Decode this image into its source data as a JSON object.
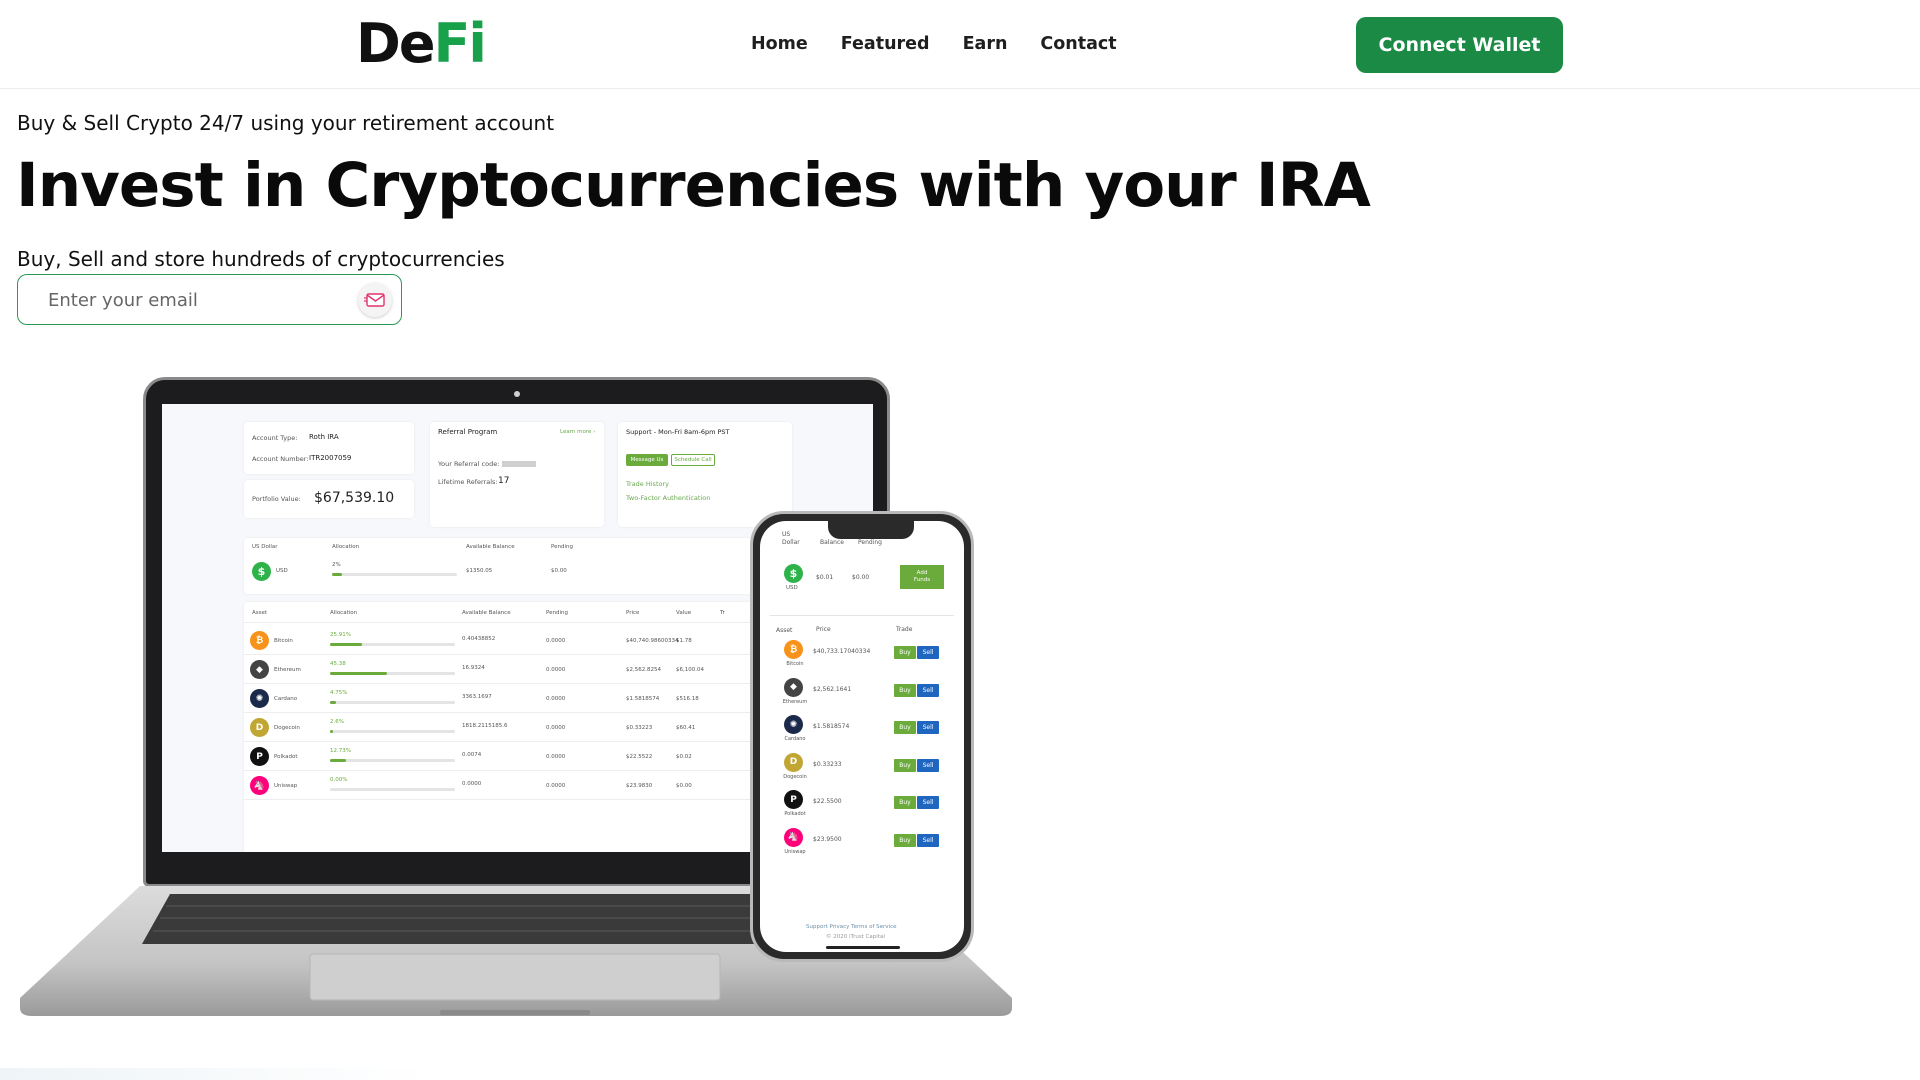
{
  "header": {
    "logo_part1": "De",
    "logo_part2": "Fi",
    "nav": [
      "Home",
      "Featured",
      "Earn",
      "Contact"
    ],
    "connect_wallet": "Connect Wallet"
  },
  "hero": {
    "eyebrow": "Buy & Sell Crypto 24/7 using your retirement account",
    "headline": "Invest in Cryptocurrencies with your IRA",
    "subline": "Buy, Sell and store hundreds of cryptocurrencies",
    "email_placeholder": "Enter your email"
  },
  "colors": {
    "brand_green": "#1a8a45",
    "logo_green": "#18a04a",
    "input_border": "#2c9a55"
  },
  "mockup": {
    "account": {
      "account_type_label": "Account Type:",
      "account_type": "Roth IRA",
      "account_number_label": "Account Number:",
      "account_number": "ITR2007059",
      "portfolio_label": "Portfolio Value:",
      "portfolio_value": "$67,539.10"
    },
    "referral": {
      "title": "Referral Program",
      "learn_more": "Learn more ›",
      "code_label": "Your Referral code:",
      "lifetime_label": "Lifetime Referrals:",
      "lifetime_value": "17"
    },
    "support": {
      "title": "Support - Mon-Fri 8am-6pm PST",
      "message_us": "Message Us",
      "schedule_call": "Schedule Call",
      "trade_history": "Trade History",
      "two_factor": "Two-Factor Authentication"
    },
    "usd": {
      "headers": [
        "US Dollar",
        "Allocation",
        "Available Balance",
        "Pending"
      ],
      "name": "USD",
      "allocation": "2%",
      "allocation_fraction": 0.02,
      "balance": "$1350.05",
      "pending": "$0.00"
    },
    "asset_headers": [
      "Asset",
      "Allocation",
      "Available Balance",
      "Pending",
      "Price",
      "Value",
      "Tr"
    ],
    "assets": [
      {
        "name": "Bitcoin",
        "allocation": "25.91%",
        "fraction": 0.2591,
        "balance": "0.40438852",
        "pending": "0.0000",
        "price": "$40,740.98600334",
        "value": "$1.78",
        "color": "#f7931a",
        "glyph": "₿"
      },
      {
        "name": "Ethereum",
        "allocation": "45.38",
        "fraction": 0.4538,
        "balance": "16.9324",
        "pending": "0.0000",
        "price": "$2,562.8254",
        "value": "$6,100.04",
        "color": "#444444",
        "glyph": "◆"
      },
      {
        "name": "Cardano",
        "allocation": "4.75%",
        "fraction": 0.0475,
        "balance": "3363.1697",
        "pending": "0.0000",
        "price": "$1.5818574",
        "value": "$516.18",
        "color": "#1b2a4a",
        "glyph": "✺"
      },
      {
        "name": "Dogecoin",
        "allocation": "2.6%",
        "fraction": 0.026,
        "balance": "1818.2115185.6",
        "pending": "0.0000",
        "price": "$0.33223",
        "value": "$60.41",
        "color": "#c2a633",
        "glyph": "D"
      },
      {
        "name": "Polkadot",
        "allocation": "12.73%",
        "fraction": 0.1273,
        "balance": "0.0074",
        "pending": "0.0000",
        "price": "$22.5522",
        "value": "$0.02",
        "color": "#111111",
        "glyph": "P"
      },
      {
        "name": "Uniswap",
        "allocation": "0.00%",
        "fraction": 0.0,
        "balance": "0.0000",
        "pending": "0.0000",
        "price": "$23.9830",
        "value": "$0.00",
        "color": "#ff007a",
        "glyph": "🦄"
      }
    ],
    "phone": {
      "usd_headers": [
        "US Dollar",
        "Balance",
        "Pending"
      ],
      "usd_name": "USD",
      "usd_balance": "$0.01",
      "usd_pending": "$0.00",
      "add_funds": "Add Funds",
      "asset_headers": [
        "Asset",
        "Price",
        "Trade"
      ],
      "buy": "Buy",
      "sell": "Sell",
      "assets": [
        {
          "name": "Bitcoin",
          "price": "$40,733.17040334"
        },
        {
          "name": "Ethereum",
          "price": "$2,562.1641"
        },
        {
          "name": "Cardano",
          "price": "$1.5818574"
        },
        {
          "name": "Dogecoin",
          "price": "$0.33233"
        },
        {
          "name": "Polkadot",
          "price": "$22.5500"
        },
        {
          "name": "Uniswap",
          "price": "$23.9500"
        }
      ],
      "footer_links": "Support  Privacy  Terms of Service",
      "copyright": "© 2020 iTrust Capital"
    }
  }
}
